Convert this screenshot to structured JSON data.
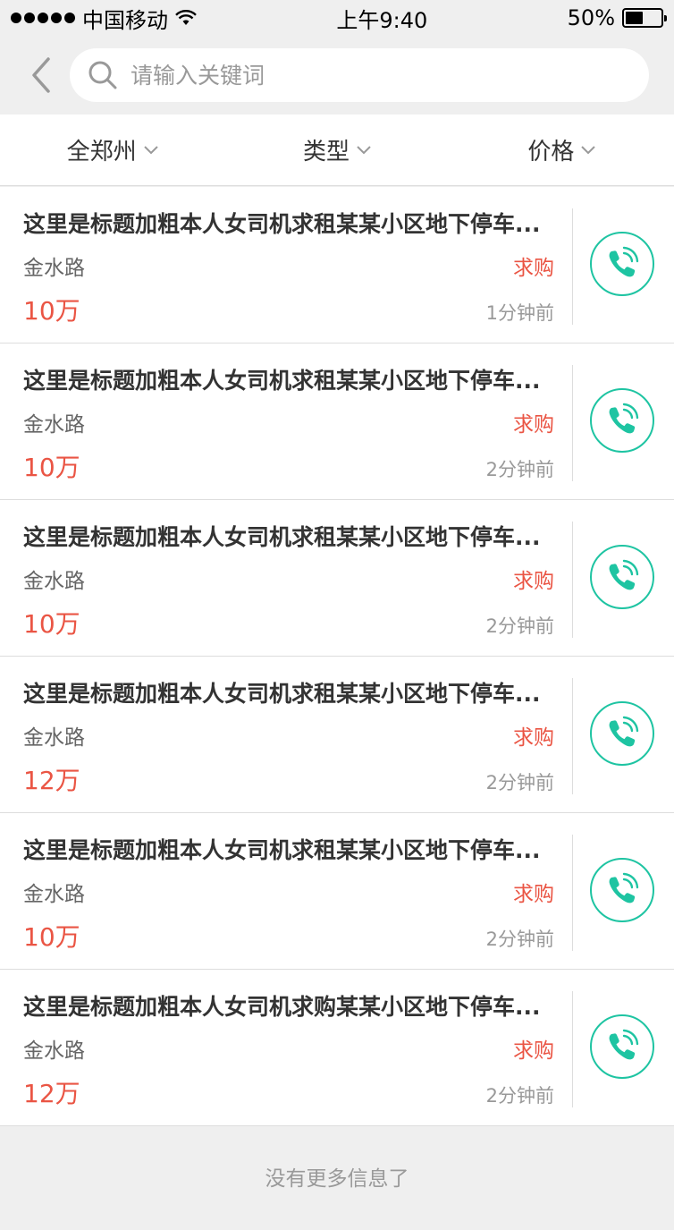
{
  "status_bar": {
    "carrier": "中国移动",
    "time": "上午9:40",
    "battery": "50%",
    "battery_level": 0.5
  },
  "search": {
    "placeholder": "请输入关键词"
  },
  "filters": [
    {
      "label": "全郑州"
    },
    {
      "label": "类型"
    },
    {
      "label": "价格"
    }
  ],
  "colors": {
    "title": "#333333",
    "road": "#666666",
    "price": "#ea5544",
    "time": "#999999",
    "divider": "#dddddd",
    "call_accent": "#1ec4a2"
  },
  "listings": [
    {
      "title": "这里是标题加粗本人女司机求租某某小区地下停车...",
      "road": "金水路",
      "price": "10万",
      "tag": "求购",
      "time": "1分钟前"
    },
    {
      "title": "这里是标题加粗本人女司机求租某某小区地下停车...",
      "road": "金水路",
      "price": "10万",
      "tag": "求购",
      "time": "2分钟前"
    },
    {
      "title": "这里是标题加粗本人女司机求租某某小区地下停车...",
      "road": "金水路",
      "price": "10万",
      "tag": "求购",
      "time": "2分钟前"
    },
    {
      "title": "这里是标题加粗本人女司机求租某某小区地下停车...",
      "road": "金水路",
      "price": "12万",
      "tag": "求购",
      "time": "2分钟前"
    },
    {
      "title": "这里是标题加粗本人女司机求租某某小区地下停车...",
      "road": "金水路",
      "price": "10万",
      "tag": "求购",
      "time": "2分钟前"
    },
    {
      "title": "这里是标题加粗本人女司机求购某某小区地下停车...",
      "road": "金水路",
      "price": "12万",
      "tag": "求购",
      "time": "2分钟前"
    }
  ],
  "icons": {
    "back": "chevron-left-icon",
    "search": "search-icon",
    "filter_arrow": "chevron-down-icon",
    "call": "phone-icon"
  },
  "footer": {
    "text": "没有更多信息了"
  }
}
